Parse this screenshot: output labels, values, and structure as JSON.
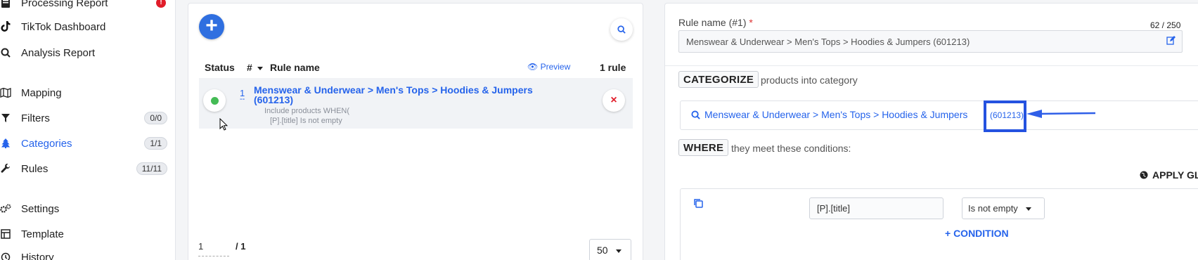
{
  "sidebar": {
    "items": [
      {
        "label": "Processing Report",
        "icon": "report-icon",
        "alert": "!"
      },
      {
        "label": "TikTok Dashboard",
        "icon": "tiktok-icon"
      },
      {
        "label": "Analysis Report",
        "icon": "search-icon"
      },
      {
        "label": "Mapping",
        "icon": "map-icon"
      },
      {
        "label": "Filters",
        "icon": "filter-icon",
        "badge": "0/0"
      },
      {
        "label": "Categories",
        "icon": "tree-icon",
        "badge": "1/1",
        "active": true
      },
      {
        "label": "Rules",
        "icon": "wrench-icon",
        "badge": "11/11"
      },
      {
        "label": "Settings",
        "icon": "gears-icon"
      },
      {
        "label": "Template",
        "icon": "template-icon"
      },
      {
        "label": "History",
        "icon": "history-icon"
      }
    ]
  },
  "list_panel": {
    "add_label": "+",
    "headers": {
      "status": "Status",
      "num": "#",
      "name": "Rule name",
      "preview": "Preview",
      "count": "1 rule"
    },
    "rows": [
      {
        "num": "1",
        "num_sub": "--",
        "title": "Menswear & Underwear > Men's Tops > Hoodies & Jumpers (601213)",
        "desc_line1": "Include products WHEN(",
        "desc_line2": "[P].[title] Is not empty",
        "delete_label": "×"
      }
    ],
    "pager": {
      "current": "1",
      "total": "/ 1",
      "per_page": "50"
    }
  },
  "rule_panel": {
    "name_label": "Rule name (#1)",
    "required_mark": "*",
    "counter": "62 / 250",
    "name_value": "Menswear & Underwear > Men's Tops > Hoodies & Jumpers (601213)",
    "categorize_kw": "CATEGORIZE",
    "categorize_text": "products into category",
    "category_link": "Menswear & Underwear > Men's Tops > Hoodies & Jumpers",
    "category_id": "(601213)",
    "where_kw": "WHERE",
    "where_text": "they meet these conditions:",
    "apply_label": "APPLY GL",
    "condition": {
      "field": "[P].[title]",
      "operator": "Is not empty"
    },
    "add_condition_label": "+ CONDITION"
  },
  "colors": {
    "accent": "#2563eb",
    "highlight": "#2452e0",
    "status_on": "#44bb55",
    "danger": "#e11d2a"
  }
}
